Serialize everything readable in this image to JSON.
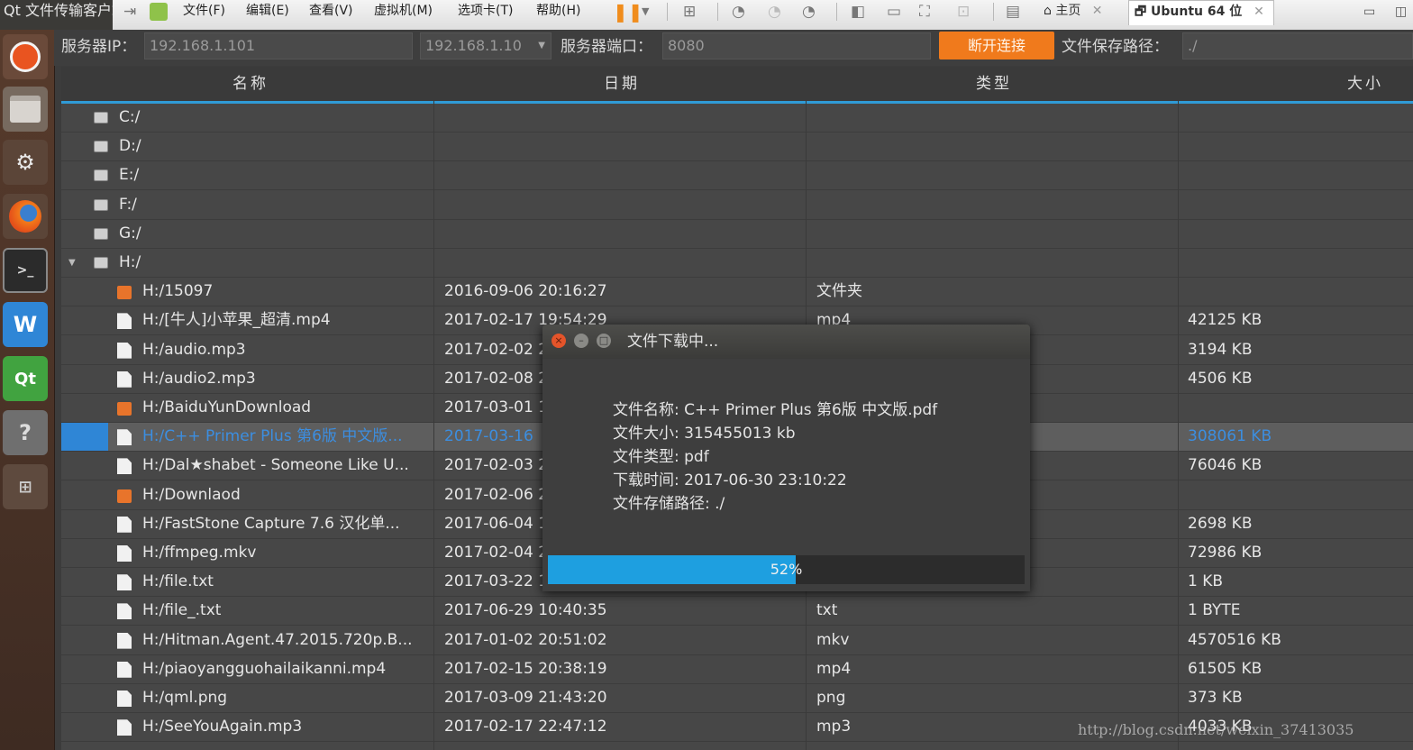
{
  "window": {
    "app_title": "Qt 文件传输客户端",
    "menus": [
      "文件(F)",
      "编辑(E)",
      "查看(V)",
      "虚拟机(M)",
      "选项卡(T)",
      "帮助(H)"
    ],
    "tabs": [
      {
        "label": "主页"
      },
      {
        "label": "Ubuntu 64 位"
      }
    ],
    "window_controls": [
      "▭",
      "◫"
    ]
  },
  "launcher": {
    "items": [
      "ubuntu-icon",
      "files-icon",
      "settings-icon",
      "firefox-icon",
      "terminal-icon",
      "wps-icon",
      "qt-icon",
      "help-icon",
      "workspace-icon"
    ],
    "glyphs": {
      "qt": "Qt",
      "help": "?",
      "terminal": ">_",
      "wps": "W"
    }
  },
  "connection": {
    "server_ip_label": "服务器IP：",
    "server_ip_value": "192.168.1.101",
    "local_ip_value": "192.168.1.10",
    "port_label": "服务器端口：",
    "port_value": "8080",
    "disconnect_label": "断开连接",
    "save_path_label": "文件保存路径：",
    "save_path_value": "./"
  },
  "table": {
    "headers": [
      "名称",
      "日期",
      "类型",
      "大小"
    ],
    "rows": [
      {
        "kind": "drive",
        "indent": 0,
        "name": "C:/",
        "date": "",
        "type": "",
        "size": ""
      },
      {
        "kind": "drive",
        "indent": 0,
        "name": "D:/",
        "date": "",
        "type": "",
        "size": ""
      },
      {
        "kind": "drive",
        "indent": 0,
        "name": "E:/",
        "date": "",
        "type": "",
        "size": ""
      },
      {
        "kind": "drive",
        "indent": 0,
        "name": "F:/",
        "date": "",
        "type": "",
        "size": ""
      },
      {
        "kind": "drive",
        "indent": 0,
        "name": "G:/",
        "date": "",
        "type": "",
        "size": ""
      },
      {
        "kind": "drive",
        "indent": 0,
        "expanded": true,
        "name": "H:/",
        "date": "",
        "type": "",
        "size": ""
      },
      {
        "kind": "folder",
        "indent": 1,
        "name": "H:/15097",
        "date": "2016-09-06 20:16:27",
        "type": "文件夹",
        "size": ""
      },
      {
        "kind": "file",
        "indent": 1,
        "name": "H:/[牛人]小苹果_超清.mp4",
        "date": "2017-02-17 19:54:29",
        "type": "mp4",
        "size": "42125 KB"
      },
      {
        "kind": "file",
        "indent": 1,
        "name": "H:/audio.mp3",
        "date": "2017-02-02 2",
        "type": "",
        "size": "3194 KB"
      },
      {
        "kind": "file",
        "indent": 1,
        "name": "H:/audio2.mp3",
        "date": "2017-02-08 2",
        "type": "",
        "size": "4506 KB"
      },
      {
        "kind": "folder",
        "indent": 1,
        "name": "H:/BaiduYunDownload",
        "date": "2017-03-01 1",
        "type": "",
        "size": ""
      },
      {
        "kind": "file",
        "indent": 1,
        "selected": true,
        "name": "H:/C++ Primer Plus 第6版 中文版...",
        "date": "2017-03-16",
        "type": "",
        "size": "308061 KB"
      },
      {
        "kind": "file",
        "indent": 1,
        "name": "H:/Dal★shabet - Someone Like U...",
        "date": "2017-02-03 2",
        "type": "",
        "size": "76046 KB"
      },
      {
        "kind": "folder",
        "indent": 1,
        "name": "H:/Downlaod",
        "date": "2017-02-06 2",
        "type": "",
        "size": ""
      },
      {
        "kind": "file",
        "indent": 1,
        "name": "H:/FastStone Capture 7.6 汉化单...",
        "date": "2017-06-04 1",
        "type": "",
        "size": "2698 KB"
      },
      {
        "kind": "file",
        "indent": 1,
        "name": "H:/ffmpeg.mkv",
        "date": "2017-02-04 2",
        "type": "",
        "size": "72986 KB"
      },
      {
        "kind": "file",
        "indent": 1,
        "name": "H:/file.txt",
        "date": "2017-03-22 1",
        "type": "txt",
        "size": "1 KB"
      },
      {
        "kind": "file",
        "indent": 1,
        "name": "H:/file_.txt",
        "date": "2017-06-29 10:40:35",
        "type": "txt",
        "size": "1 BYTE"
      },
      {
        "kind": "file",
        "indent": 1,
        "name": "H:/Hitman.Agent.47.2015.720p.B...",
        "date": "2017-01-02 20:51:02",
        "type": "mkv",
        "size": "4570516 KB"
      },
      {
        "kind": "file",
        "indent": 1,
        "name": "H:/piaoyangguohailaikanni.mp4",
        "date": "2017-02-15 20:38:19",
        "type": "mp4",
        "size": "61505 KB"
      },
      {
        "kind": "file",
        "indent": 1,
        "name": "H:/qml.png",
        "date": "2017-03-09 21:43:20",
        "type": "png",
        "size": "373 KB"
      },
      {
        "kind": "file",
        "indent": 1,
        "name": "H:/SeeYouAgain.mp3",
        "date": "2017-02-17 22:47:12",
        "type": "mp3",
        "size": "4033 KB"
      }
    ]
  },
  "download_dialog": {
    "title": "文件下载中...",
    "close_glyph": "×",
    "minimize_glyph": "–",
    "maximize_glyph": "□",
    "lines": [
      "文件名称: C++ Primer Plus 第6版 中文版.pdf",
      "文件大小: 315455013 kb",
      "文件类型: pdf",
      "下载时间: 2017-06-30 23:10:22",
      "文件存储路径: ./"
    ],
    "progress": 0.52,
    "progress_text": "52%"
  },
  "watermark": "http://blog.csdn.net/weixin_37413035",
  "colors": {
    "accent_orange": "#f07a1c",
    "progress_blue": "#1e9fe0",
    "header_underline": "#2f9bd7",
    "selection_text": "#3c8ee0"
  }
}
